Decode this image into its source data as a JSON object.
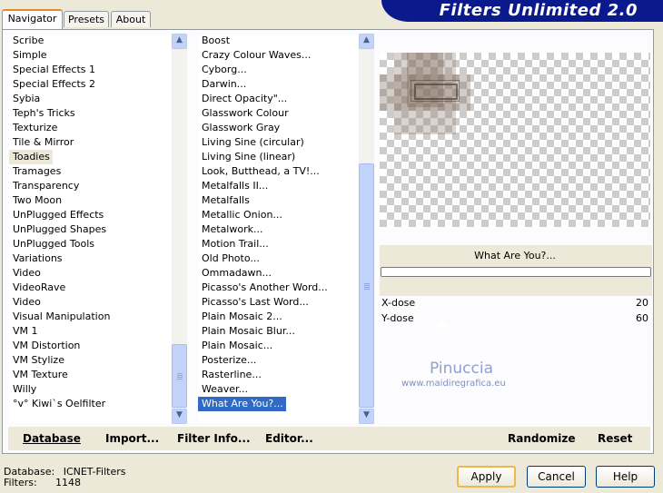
{
  "tabs": [
    "Navigator",
    "Presets",
    "About"
  ],
  "banner_title": "Filters Unlimited 2.0",
  "categories": [
    "Scribe",
    "Simple",
    "Special Effects 1",
    "Special Effects 2",
    "Sybia",
    "Teph's Tricks",
    "Texturize",
    "Tile & Mirror",
    "Toadies",
    "Tramages",
    "Transparency",
    "Two Moon",
    "UnPlugged Effects",
    "UnPlugged Shapes",
    "UnPlugged Tools",
    "Variations",
    "Video",
    "VideoRave",
    "Video",
    "Visual Manipulation",
    "VM 1",
    "VM Distortion",
    "VM Stylize",
    "VM Texture",
    "Willy",
    "°v° Kiwi`s Oelfilter"
  ],
  "filters": [
    "Boost",
    "Crazy Colour Waves...",
    "Cyborg...",
    "Darwin...",
    "Direct Opacity\"...",
    "Glasswork Colour",
    "Glasswork Gray",
    "Living Sine (circular)",
    "Living Sine (linear)",
    "Look, Butthead, a TV!...",
    "Metalfalls II...",
    "Metalfalls",
    "Metallic Onion...",
    "Metalwork...",
    "Motion Trail...",
    "Old Photo...",
    "Ommadawn...",
    "Picasso's Another Word...",
    "Picasso's Last Word...",
    "Plain Mosaic 2...",
    "Plain Mosaic Blur...",
    "Plain Mosaic...",
    "Posterize...",
    "Rasterline...",
    "Weaver...",
    "What Are You?..."
  ],
  "filter_name": "What Are You?...",
  "params": [
    {
      "label": "X-dose",
      "value": "20"
    },
    {
      "label": "Y-dose",
      "value": "60"
    }
  ],
  "watermark": {
    "name": "Pinuccia",
    "site": "www.maidiregrafica.eu"
  },
  "bottom_buttons": {
    "database": "Database",
    "import": "Import...",
    "filter_info": "Filter Info...",
    "editor": "Editor...",
    "randomize": "Randomize",
    "reset": "Reset"
  },
  "status": {
    "database_label": "Database:",
    "database_value": "ICNET-Filters",
    "filters_label": "Filters:",
    "filters_value": "1148"
  },
  "dialog_buttons": {
    "apply": "Apply",
    "cancel": "Cancel",
    "help": "Help"
  },
  "colors": {
    "banner": "#0a1a8c",
    "selection": "#316ac5",
    "scroll": "#c1d3fb",
    "face": "#ece9d8"
  }
}
